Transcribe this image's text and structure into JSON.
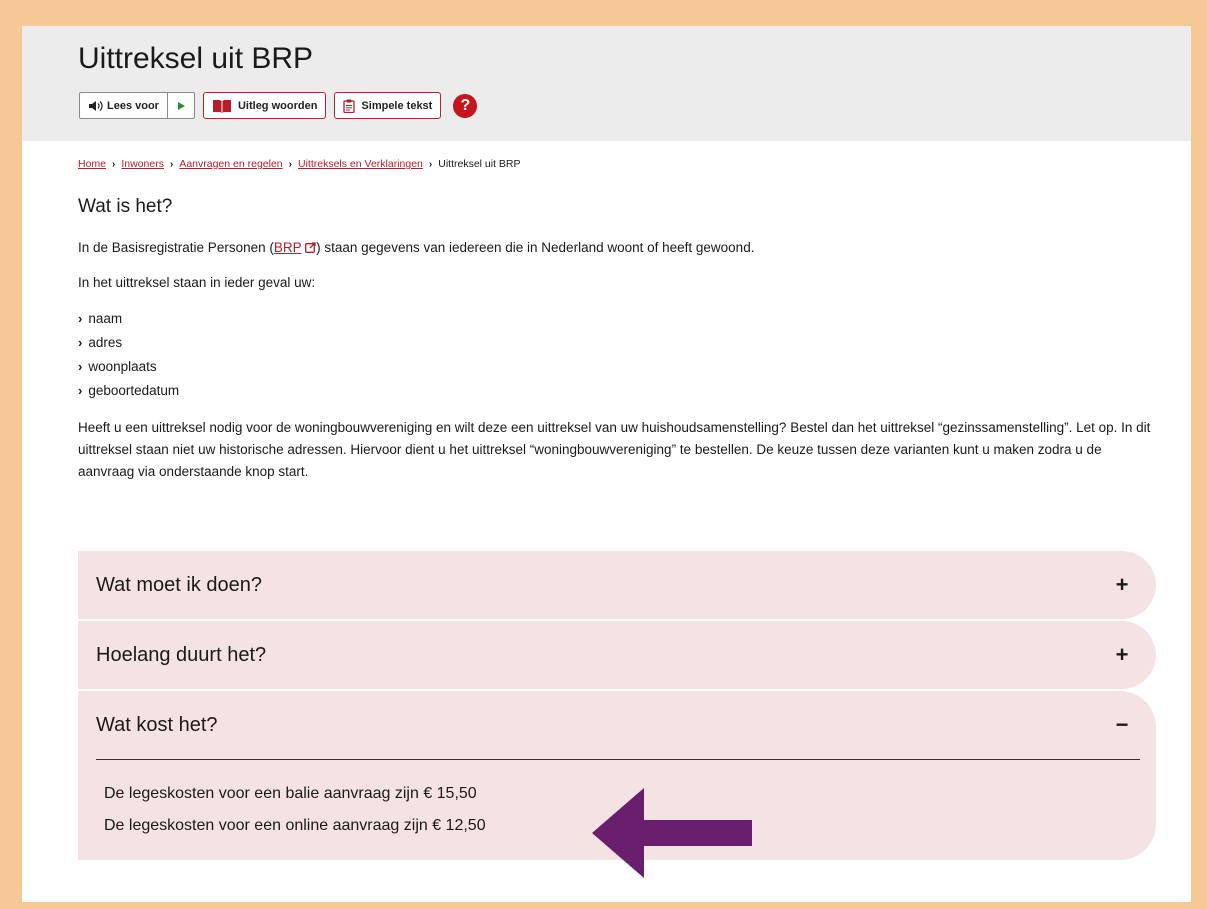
{
  "header": {
    "title": "Uittreksel uit BRP",
    "toolbar": {
      "read_aloud_label": "Lees voor",
      "glossary_label": "Uitleg woorden",
      "simple_text_label": "Simpele tekst",
      "help_label": "?"
    }
  },
  "breadcrumb": {
    "items": [
      "Home",
      "Inwoners",
      "Aanvragen en regelen",
      "Uittreksels en Verklaringen"
    ],
    "current": "Uittreksel uit BRP"
  },
  "content": {
    "heading": "Wat is het?",
    "intro_before": "In de Basisregistratie Personen (",
    "intro_link": "BRP",
    "intro_after": ") staan gegevens van iedereen die in Nederland woont of heeft gewoond.",
    "list_intro": "In het uittreksel staan in ieder geval uw:",
    "list_items": [
      "naam",
      "adres",
      "woonplaats",
      "geboortedatum"
    ],
    "long_paragraph": "Heeft u een uittreksel nodig voor de woningbouwvereniging en wilt deze een uittreksel van uw huishoudsamenstelling? Bestel dan het uittreksel “gezinssamenstelling”. Let op. In dit uittreksel staan niet uw historische adressen. Hiervoor dient u het uittreksel “woningbouwvereniging” te bestellen. De keuze tussen deze varianten kunt u maken zodra u de aanvraag via onderstaande knop start."
  },
  "accordion": [
    {
      "title": "Wat moet ik doen?",
      "toggle": "+",
      "expanded": false
    },
    {
      "title": "Hoelang duurt het?",
      "toggle": "+",
      "expanded": false
    },
    {
      "title": "Wat kost het?",
      "toggle": "−",
      "expanded": true,
      "body": [
        "De legeskosten voor een balie aanvraag zijn € 15,50",
        "De legeskosten voor een online aanvraag zijn € 12,50"
      ]
    }
  ],
  "colors": {
    "frame_background": "#f6c896",
    "accent_red": "#b51e2a",
    "accordion_background": "#f5e3e3",
    "arrow": "#6a1f6e"
  }
}
